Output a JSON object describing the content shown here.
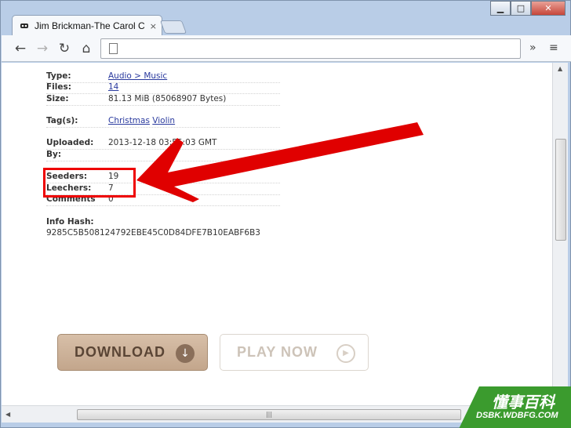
{
  "browser": {
    "tab_title": "Jim Brickman-The Carol C",
    "tab_close": "×",
    "window_controls": {
      "minimize": "▁",
      "maximize": "□",
      "close": "✕"
    },
    "nav": {
      "back": "←",
      "forward": "→",
      "reload": "↻",
      "home": "⌂"
    },
    "address_value": "",
    "overflow": "»",
    "menu": "≡"
  },
  "details": [
    {
      "label": "Type:",
      "value": "Audio > Music",
      "link": true
    },
    {
      "label": "Files:",
      "value": "14",
      "link": true
    },
    {
      "label": "Size:",
      "value": "81.13 MiB (85068907 Bytes)",
      "link": false
    },
    {
      "label": "Tag(s):",
      "values": [
        "Christmas",
        "Violin"
      ]
    },
    {
      "label": "Uploaded:",
      "value": "2013-12-18 03:55:03 GMT"
    },
    {
      "label": "By:",
      "value": ""
    },
    {
      "label": "Seeders:",
      "value": "19"
    },
    {
      "label": "Leechers:",
      "value": "7"
    },
    {
      "label": "Comments",
      "value": "0"
    }
  ],
  "info_hash": {
    "label": "Info Hash:",
    "value": "9285C5B508124792EBE45C0D84DFE7B10EABF6B3"
  },
  "buttons": {
    "download": "DOWNLOAD",
    "play": "PLAY NOW"
  },
  "annotation_color": "#e00000",
  "watermark": {
    "cn": "懂事百科",
    "url": "DSBK.WDBFG.COM"
  }
}
